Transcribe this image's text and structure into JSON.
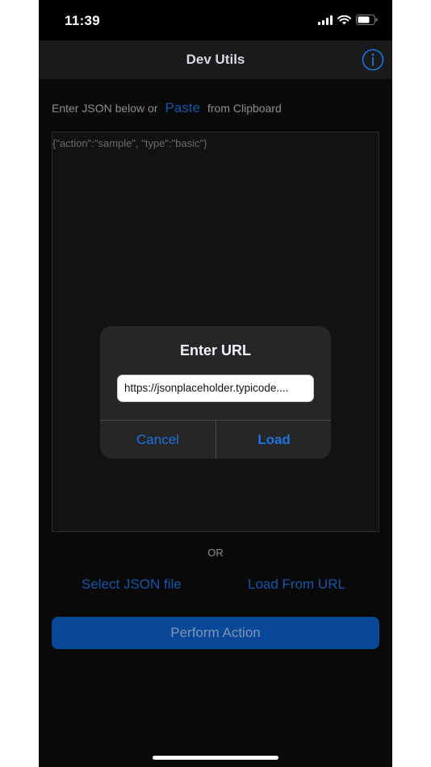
{
  "status_bar": {
    "time": "11:39",
    "icons": [
      "signal-icon",
      "wifi-icon",
      "battery-icon"
    ]
  },
  "nav": {
    "title": "Dev Utils",
    "info_icon": "info-icon"
  },
  "prompt": {
    "before": "Enter JSON below or",
    "paste_link": "Paste",
    "after": "from Clipboard"
  },
  "editor": {
    "value": "{\"action\":\"sample\", \"type\":\"basic\"}"
  },
  "alert": {
    "title": "Enter URL",
    "input_value": "https://jsonplaceholder.typicode....",
    "cancel_label": "Cancel",
    "load_label": "Load"
  },
  "or_label": "OR",
  "actions": {
    "select_file": "Select JSON file",
    "load_from_url": "Load From URL",
    "perform": "Perform Action"
  },
  "colors": {
    "accent": "#1a73e0",
    "primary_button": "#0c5fcc",
    "background": "#0c0c0c",
    "alert_background": "#262628"
  }
}
